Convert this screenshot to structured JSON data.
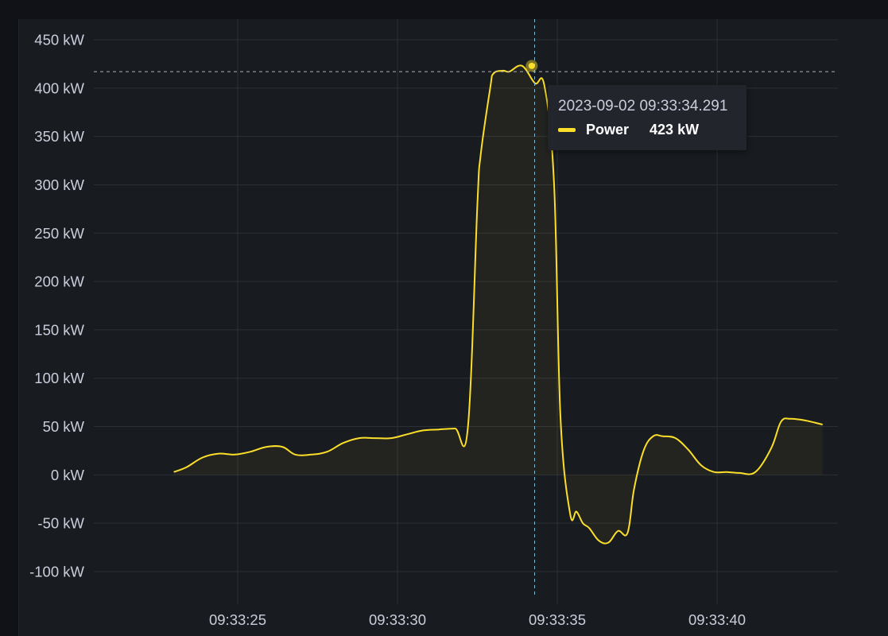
{
  "chart_data": {
    "type": "line",
    "title": "",
    "xlabel": "",
    "ylabel": "",
    "unit": "kW",
    "ylim": [
      -100,
      450
    ],
    "y_ticks": [
      450,
      400,
      350,
      300,
      250,
      200,
      150,
      100,
      50,
      0,
      -50,
      -100
    ],
    "y_tick_labels": [
      "450 kW",
      "400 kW",
      "350 kW",
      "300 kW",
      "250 kW",
      "200 kW",
      "150 kW",
      "100 kW",
      "50 kW",
      "0 kW",
      "-50 kW",
      "-100 kW"
    ],
    "x_ticks": [
      25,
      30,
      35,
      40
    ],
    "x_tick_labels": [
      "09:33:25",
      "09:33:30",
      "09:33:35",
      "09:33:40"
    ],
    "x_unit": "seconds past 09:33:00",
    "grid": true,
    "series": [
      {
        "name": "Power",
        "color": "#fade2a",
        "x": [
          23.0,
          23.4,
          23.9,
          24.4,
          24.9,
          25.4,
          25.9,
          26.4,
          26.8,
          27.3,
          27.8,
          28.3,
          28.8,
          29.3,
          29.8,
          30.3,
          30.8,
          31.3,
          31.8,
          32.2,
          32.5,
          32.6,
          32.9,
          33.0,
          33.3,
          33.5,
          33.9,
          34.3,
          34.6,
          34.9,
          35.1,
          35.4,
          35.6,
          35.8,
          36.0,
          36.3,
          36.6,
          36.9,
          37.2,
          37.4,
          37.7,
          38.0,
          38.3,
          38.7,
          39.1,
          39.5,
          39.9,
          40.3,
          40.7,
          41.2,
          41.7,
          42.0,
          42.3,
          42.8,
          43.3
        ],
        "y": [
          3,
          8,
          18,
          22,
          21,
          24,
          29,
          29,
          21,
          21,
          24,
          33,
          38,
          38,
          38,
          42,
          46,
          47,
          48,
          48,
          280,
          330,
          400,
          415,
          418,
          417,
          423,
          405,
          402,
          300,
          60,
          -40,
          -38,
          -50,
          -55,
          -68,
          -70,
          -58,
          -60,
          -15,
          25,
          40,
          40,
          38,
          26,
          10,
          3,
          3,
          2,
          3,
          28,
          55,
          58,
          56,
          52
        ]
      }
    ],
    "tooltip": {
      "timestamp": "2023-09-02 09:33:34.291",
      "series_name": "Power",
      "value_label": "423 kW",
      "value": 423
    },
    "crosshair": {
      "x": 34.291,
      "y": 417
    },
    "colors": {
      "line": "#fade2a",
      "grid": "#2c3036",
      "axis_text": "#ccccdc",
      "crosshair": "#7eb8d4"
    }
  }
}
